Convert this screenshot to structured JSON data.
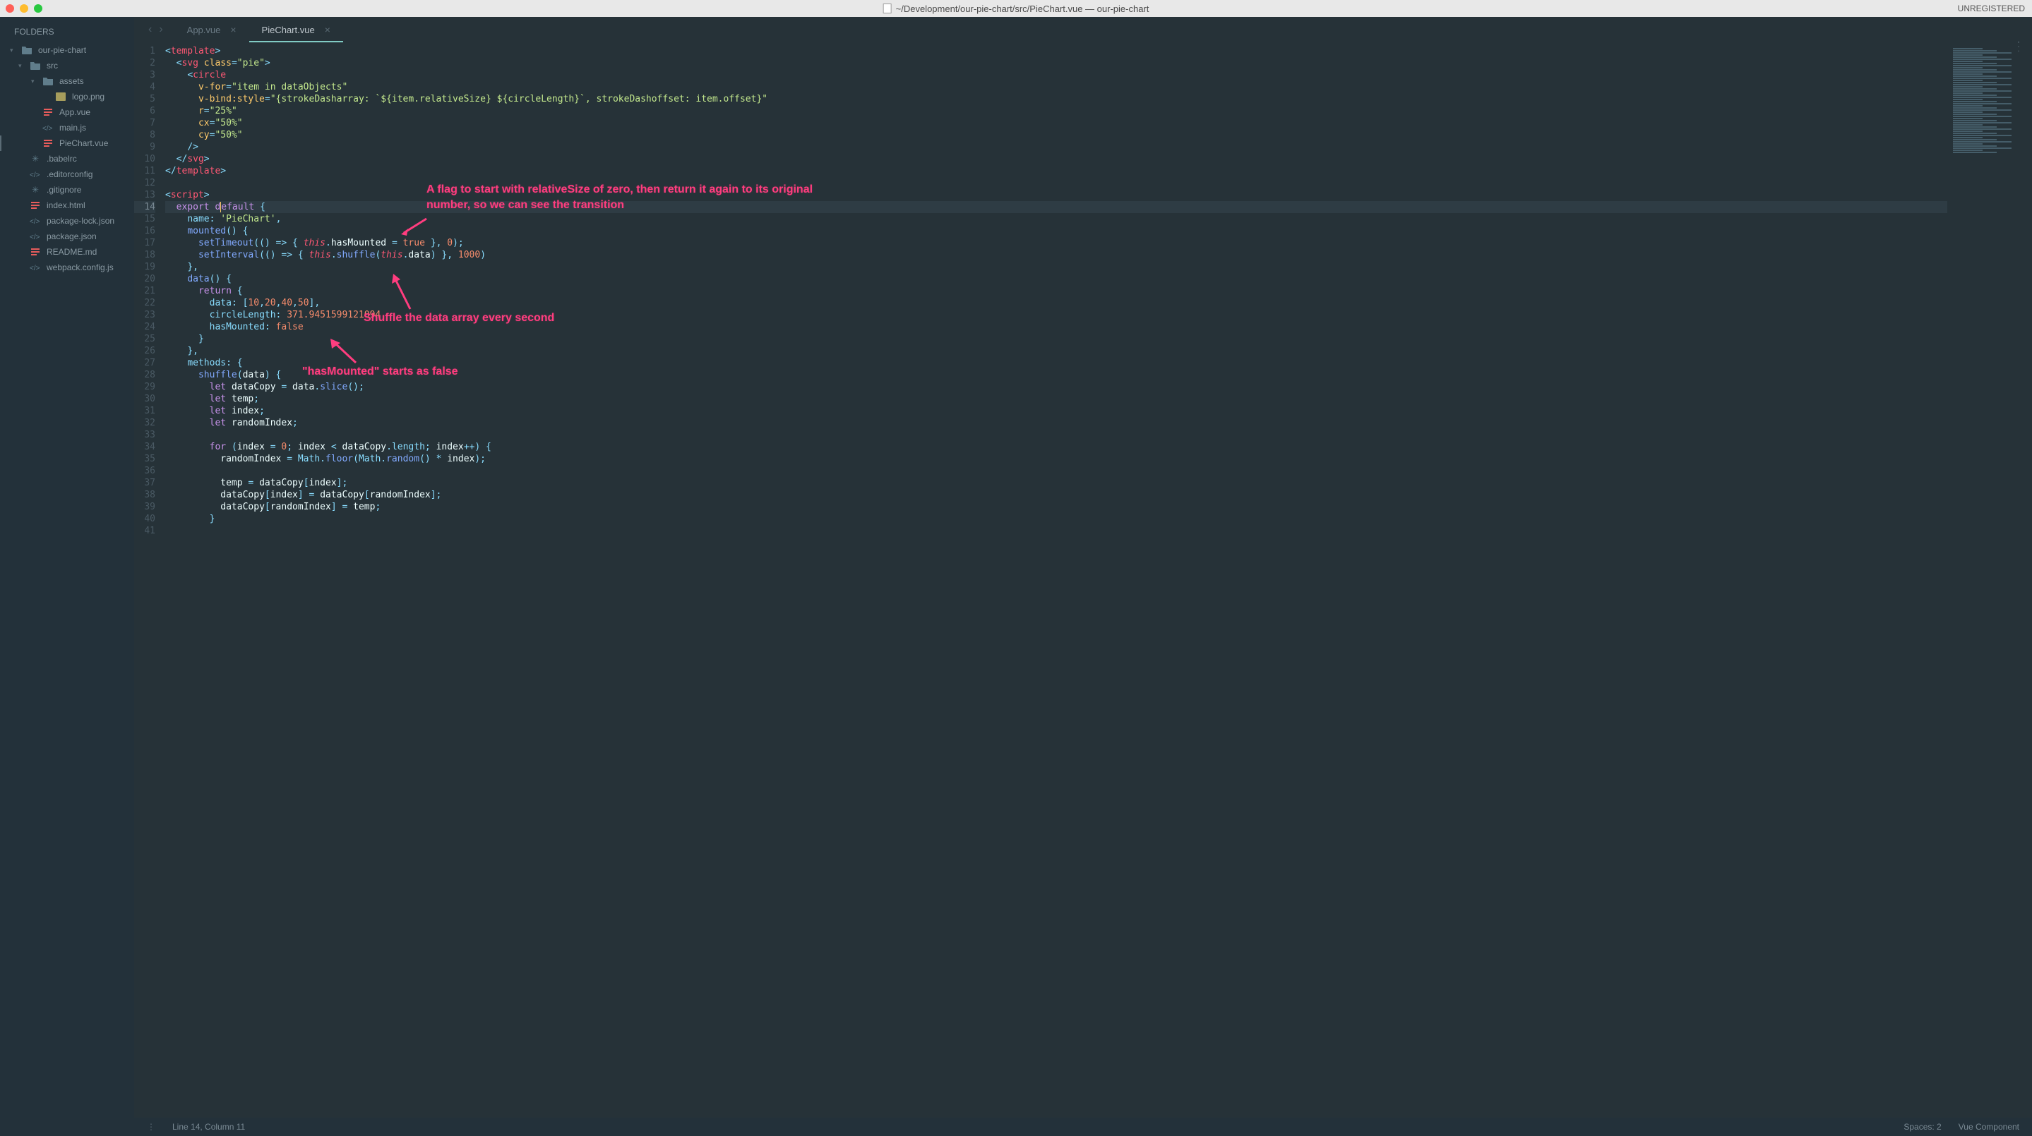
{
  "titlebar": {
    "path": "~/Development/our-pie-chart/src/PieChart.vue — our-pie-chart",
    "status": "UNREGISTERED"
  },
  "sidebar": {
    "header": "FOLDERS",
    "items": [
      {
        "label": "our-pie-chart",
        "type": "folder",
        "indent": 0,
        "open": true
      },
      {
        "label": "src",
        "type": "folder",
        "indent": 1,
        "open": true
      },
      {
        "label": "assets",
        "type": "folder",
        "indent": 2,
        "open": true
      },
      {
        "label": "logo.png",
        "type": "img",
        "indent": 3
      },
      {
        "label": "App.vue",
        "type": "vue",
        "indent": 2
      },
      {
        "label": "main.js",
        "type": "js",
        "indent": 2
      },
      {
        "label": "PieChart.vue",
        "type": "vue",
        "indent": 2,
        "active": true
      },
      {
        "label": ".babelrc",
        "type": "generic",
        "indent": 1
      },
      {
        "label": ".editorconfig",
        "type": "js",
        "indent": 1
      },
      {
        "label": ".gitignore",
        "type": "generic",
        "indent": 1
      },
      {
        "label": "index.html",
        "type": "vue",
        "indent": 1
      },
      {
        "label": "package-lock.json",
        "type": "js",
        "indent": 1
      },
      {
        "label": "package.json",
        "type": "js",
        "indent": 1
      },
      {
        "label": "README.md",
        "type": "vue",
        "indent": 1
      },
      {
        "label": "webpack.config.js",
        "type": "js",
        "indent": 1
      }
    ]
  },
  "tabs": [
    {
      "label": "App.vue",
      "active": false
    },
    {
      "label": "PieChart.vue",
      "active": true
    }
  ],
  "editor": {
    "active_line": 14,
    "lines": [
      "1",
      "2",
      "3",
      "4",
      "5",
      "6",
      "7",
      "8",
      "9",
      "10",
      "11",
      "12",
      "13",
      "14",
      "15",
      "16",
      "17",
      "18",
      "19",
      "20",
      "21",
      "22",
      "23",
      "24",
      "25",
      "26",
      "27",
      "28",
      "29",
      "30",
      "31",
      "32",
      "33",
      "34",
      "35",
      "36",
      "37",
      "38",
      "39",
      "40",
      "41"
    ]
  },
  "annotations": {
    "a1": "A flag to start with relativeSize of zero, then return it again to its original number, so we can see the transition",
    "a2": "Shuffle the data array every second",
    "a3": "\"hasMounted\" starts as false"
  },
  "statusbar": {
    "position": "Line 14, Column 11",
    "spaces": "Spaces: 2",
    "syntax": "Vue Component"
  }
}
